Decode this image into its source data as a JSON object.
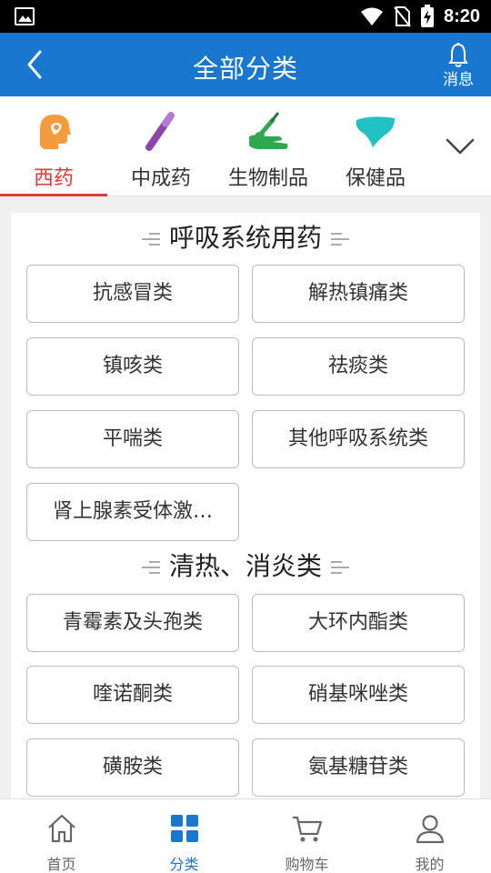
{
  "status_bar": {
    "time": "8:20"
  },
  "header": {
    "title": "全部分类",
    "message_label": "消息"
  },
  "category_tabs": [
    {
      "label": "西药",
      "icon": "head-profile-icon",
      "active": true
    },
    {
      "label": "中成药",
      "icon": "capsule-icon",
      "active": false
    },
    {
      "label": "生物制品",
      "icon": "hand-syringe-icon",
      "active": false
    },
    {
      "label": "保健品",
      "icon": "liver-icon",
      "active": false
    }
  ],
  "sections": [
    {
      "title": "呼吸系统用药",
      "items": [
        "抗感冒类",
        "解热镇痛类",
        "镇咳类",
        "祛痰类",
        "平喘类",
        "其他呼吸系统类",
        "肾上腺素受体激…"
      ]
    },
    {
      "title": "清热、消炎类",
      "items": [
        "青霉素及头孢类",
        "大环内酯类",
        "喹诺酮类",
        "硝基咪唑类",
        "磺胺类",
        "氨基糖苷类"
      ]
    }
  ],
  "bottom_nav": [
    {
      "label": "首页",
      "icon": "home-icon",
      "active": false
    },
    {
      "label": "分类",
      "icon": "grid-icon",
      "active": true
    },
    {
      "label": "购物车",
      "icon": "cart-icon",
      "active": false
    },
    {
      "label": "我的",
      "icon": "user-icon",
      "active": false
    }
  ],
  "colors": {
    "primary": "#1977cf",
    "accent_active": "#e53935",
    "tab_icon_orange": "#f39c3d",
    "tab_icon_purple": "#8e44ad",
    "tab_icon_green": "#2fa84f",
    "tab_icon_teal": "#22c1c3"
  }
}
